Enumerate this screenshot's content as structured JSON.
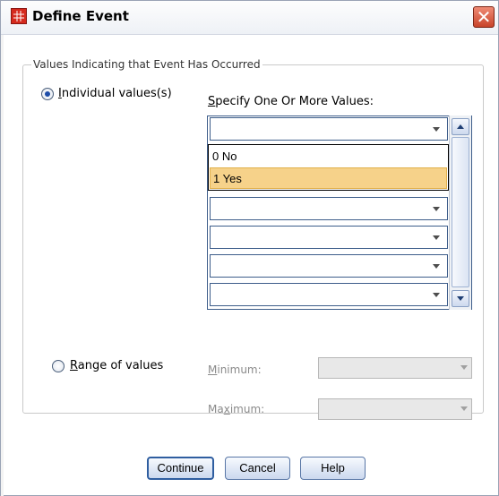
{
  "window": {
    "title": "Define Event",
    "close_glyph": "✕"
  },
  "group": {
    "legend": "Values Indicating that Event Has Occurred"
  },
  "individual": {
    "label": "Individual values(s)",
    "mnemonic": "I",
    "rest": "ndividual values(s)",
    "checked": true,
    "list_header_mnemonic": "S",
    "list_header_rest": "pecify One Or More Values:",
    "rows": [
      "",
      "",
      "",
      "",
      "",
      ""
    ]
  },
  "dropdown": {
    "options": [
      "0 No",
      "1 Yes"
    ],
    "selected_index": 1
  },
  "range": {
    "label": "Range of values",
    "mnemonic": "R",
    "rest": "ange of values",
    "checked": false,
    "minimum_mnemonic": "M",
    "minimum_rest": "inimum:",
    "maximum_prefix": "Ma",
    "maximum_mnemonic": "x",
    "maximum_rest": "imum:"
  },
  "buttons": {
    "continue": "Continue",
    "cancel": "Cancel",
    "help": "Help"
  },
  "colors": {
    "selection": "#f6d28a",
    "close_button": "#c8442a",
    "default_button_border": "#2f5ea0"
  }
}
